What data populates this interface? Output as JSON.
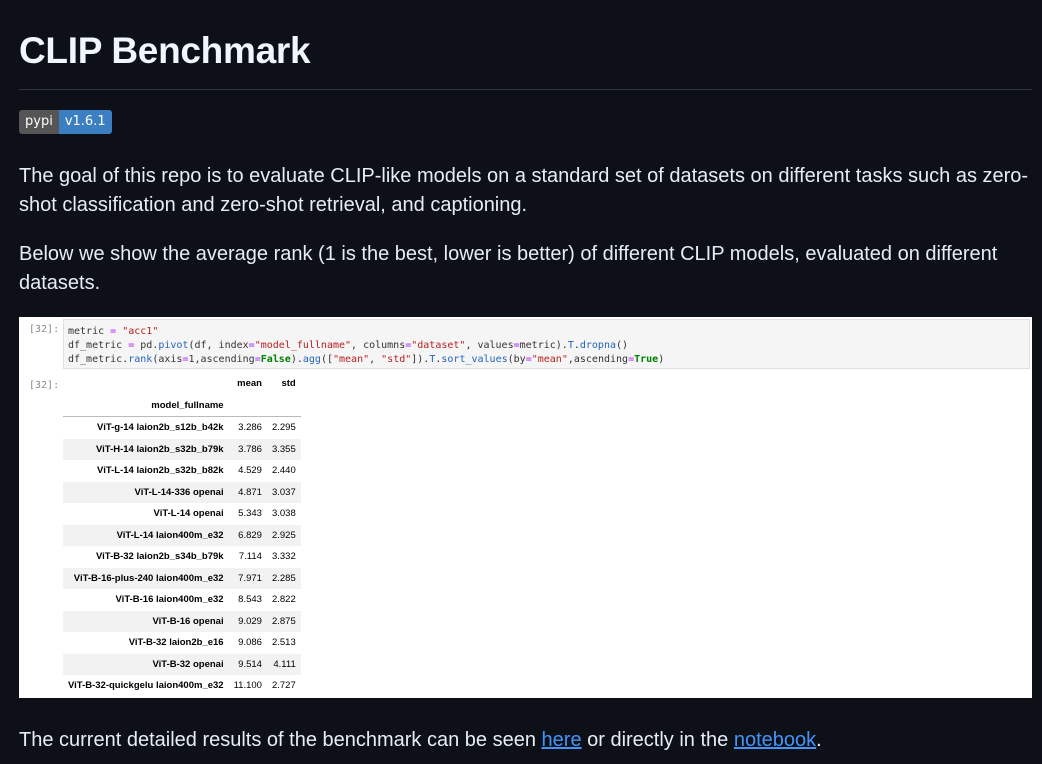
{
  "header": {
    "title": "CLIP Benchmark"
  },
  "badge": {
    "left": "pypi",
    "right": "v1.6.1"
  },
  "intro": {
    "paragraph1": "The goal of this repo is to evaluate CLIP-like models on a standard set of datasets on different tasks such as zero-shot classification and zero-shot retrieval, and captioning.",
    "paragraph2": "Below we show the average rank (1 is the best, lower is better) of different CLIP models, evaluated on different datasets."
  },
  "notebook": {
    "input_prompt": "[32]:",
    "output_prompt": "[32]:",
    "code_lines": [
      "metric = \"acc1\"",
      "df_metric = pd.pivot(df, index=\"model_fullname\", columns=\"dataset\", values=metric).T.dropna()",
      "df_metric.rank(axis=1,ascending=False).agg([\"mean\", \"std\"]).T.sort_values(by=\"mean\",ascending=True)"
    ],
    "table": {
      "columns": [
        "mean",
        "std"
      ],
      "index_name": "model_fullname",
      "rows": [
        {
          "model": "ViT-g-14 laion2b_s12b_b42k",
          "mean": "3.286",
          "std": "2.295"
        },
        {
          "model": "ViT-H-14 laion2b_s32b_b79k",
          "mean": "3.786",
          "std": "3.355"
        },
        {
          "model": "ViT-L-14 laion2b_s32b_b82k",
          "mean": "4.529",
          "std": "2.440"
        },
        {
          "model": "ViT-L-14-336 openai",
          "mean": "4.871",
          "std": "3.037"
        },
        {
          "model": "ViT-L-14 openai",
          "mean": "5.343",
          "std": "3.038"
        },
        {
          "model": "ViT-L-14 laion400m_e32",
          "mean": "6.829",
          "std": "2.925"
        },
        {
          "model": "ViT-B-32 laion2b_s34b_b79k",
          "mean": "7.114",
          "std": "3.332"
        },
        {
          "model": "ViT-B-16-plus-240 laion400m_e32",
          "mean": "7.971",
          "std": "2.285"
        },
        {
          "model": "ViT-B-16 laion400m_e32",
          "mean": "8.543",
          "std": "2.822"
        },
        {
          "model": "ViT-B-16 openai",
          "mean": "9.029",
          "std": "2.875"
        },
        {
          "model": "ViT-B-32 laion2b_e16",
          "mean": "9.086",
          "std": "2.513"
        },
        {
          "model": "ViT-B-32 openai",
          "mean": "9.514",
          "std": "4.111"
        },
        {
          "model": "ViT-B-32-quickgelu laion400m_e32",
          "mean": "11.100",
          "std": "2.727"
        }
      ]
    }
  },
  "footer": {
    "text_before": "The current detailed results of the benchmark can be seen ",
    "link1": "here",
    "text_middle": " or directly in the ",
    "link2": "notebook",
    "text_after": "."
  }
}
